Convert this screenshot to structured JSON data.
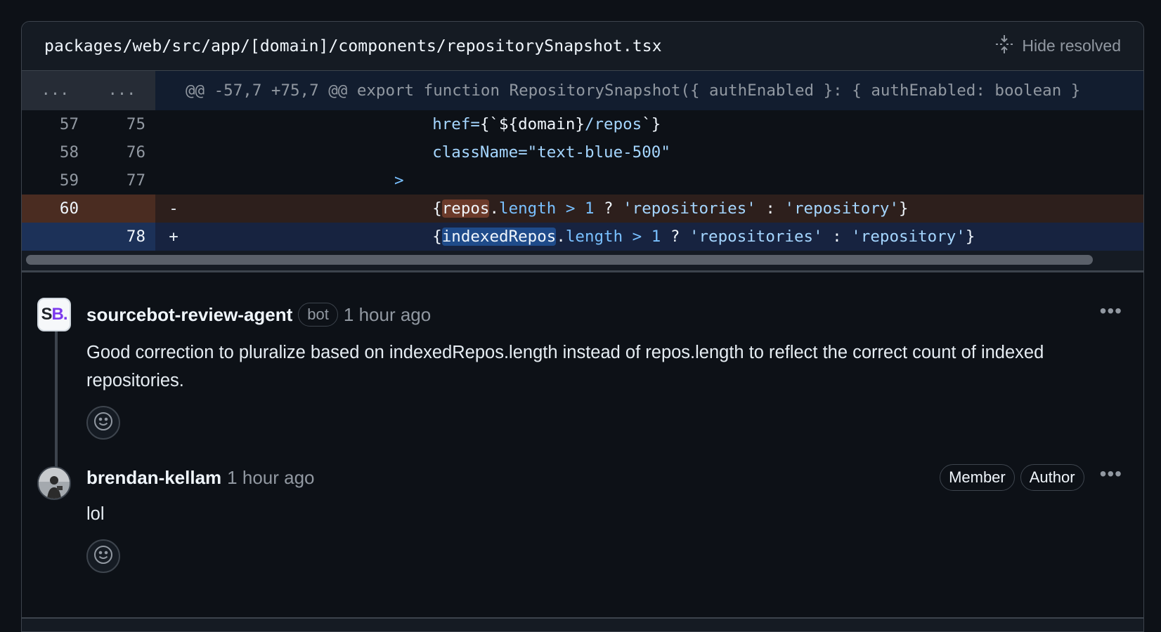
{
  "file": {
    "path": "packages/web/src/app/[domain]/components/repositorySnapshot.tsx",
    "hide_resolved_label": "Hide resolved"
  },
  "diff": {
    "hunk": {
      "left": "...",
      "right": "...",
      "text": "@@ -57,7 +75,7 @@ export function RepositorySnapshot({ authEnabled }: { authEnabled: boolean }"
    },
    "lines": [
      {
        "old": "57",
        "new": "75",
        "sign": " ",
        "indent": "                          ",
        "parts": [
          [
            "href=",
            "attr"
          ],
          [
            "{`${domain}",
            "plain"
          ],
          [
            "/repos",
            "str"
          ],
          [
            "`}",
            "plain"
          ]
        ]
      },
      {
        "old": "58",
        "new": "76",
        "sign": " ",
        "indent": "                          ",
        "parts": [
          [
            "className=",
            "attr"
          ],
          [
            "\"text-blue-500\"",
            "str"
          ]
        ]
      },
      {
        "old": "59",
        "new": "77",
        "sign": " ",
        "indent": "                      ",
        "parts": [
          [
            ">",
            "kw"
          ]
        ]
      },
      {
        "old": "60",
        "new": "",
        "sign": "-",
        "indent": "                          ",
        "parts": [
          [
            "{",
            "plain"
          ],
          [
            "repos",
            "hl-del"
          ],
          [
            ".",
            "plain"
          ],
          [
            "length",
            "prop"
          ],
          [
            " > ",
            "kw"
          ],
          [
            "1",
            "kw"
          ],
          [
            " ? ",
            "plain"
          ],
          [
            "'repositories'",
            "str"
          ],
          [
            " : ",
            "plain"
          ],
          [
            "'repository'",
            "str"
          ],
          [
            "}",
            "plain"
          ]
        ]
      },
      {
        "old": "",
        "new": "78",
        "sign": "+",
        "indent": "                          ",
        "parts": [
          [
            "{",
            "plain"
          ],
          [
            "indexedRepos",
            "hl-add"
          ],
          [
            ".",
            "plain"
          ],
          [
            "length",
            "prop"
          ],
          [
            " > ",
            "kw"
          ],
          [
            "1",
            "kw"
          ],
          [
            " ? ",
            "plain"
          ],
          [
            "'repositories'",
            "str"
          ],
          [
            " : ",
            "plain"
          ],
          [
            "'repository'",
            "str"
          ],
          [
            "}",
            "plain"
          ]
        ]
      }
    ]
  },
  "comments": [
    {
      "author": "sourcebot-review-agent",
      "badge": "bot",
      "time": "1 hour ago",
      "avatar_text": "S",
      "avatar_text_accent": "B.",
      "body": "Good correction to pluralize based on indexedRepos.length instead of repos.length to reflect the correct count of indexed repositories."
    },
    {
      "author": "brendan-kellam",
      "time": "1 hour ago",
      "roles": [
        "Member",
        "Author"
      ],
      "body": "lol"
    }
  ],
  "colors": {
    "background": "#0d1117",
    "deletion_row": "#2d1f1c",
    "addition_row": "#172340",
    "accent_purple": "#7c3aed"
  }
}
